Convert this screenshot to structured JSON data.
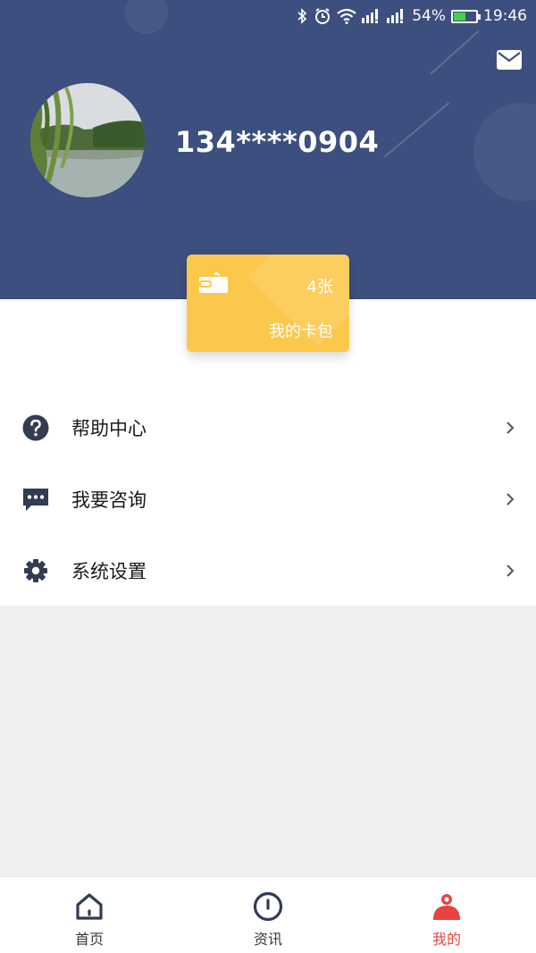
{
  "status_bar": {
    "battery_percent": "54%",
    "time": "19:46",
    "battery_level": 0.54
  },
  "profile": {
    "phone": "134****0904"
  },
  "card": {
    "count": "4张",
    "title": "我的卡包"
  },
  "menu": [
    {
      "label": "帮助中心",
      "icon": "help-icon"
    },
    {
      "label": "我要咨询",
      "icon": "chat-icon"
    },
    {
      "label": "系统设置",
      "icon": "gear-icon"
    }
  ],
  "nav": [
    {
      "label": "首页",
      "icon": "home-icon"
    },
    {
      "label": "资讯",
      "icon": "info-icon"
    },
    {
      "label": "我的",
      "icon": "user-icon",
      "active": true
    }
  ],
  "colors": {
    "header": "#3d4f7e",
    "card": "#fcc84b",
    "active": "#e8443f",
    "icon": "#323c52"
  }
}
